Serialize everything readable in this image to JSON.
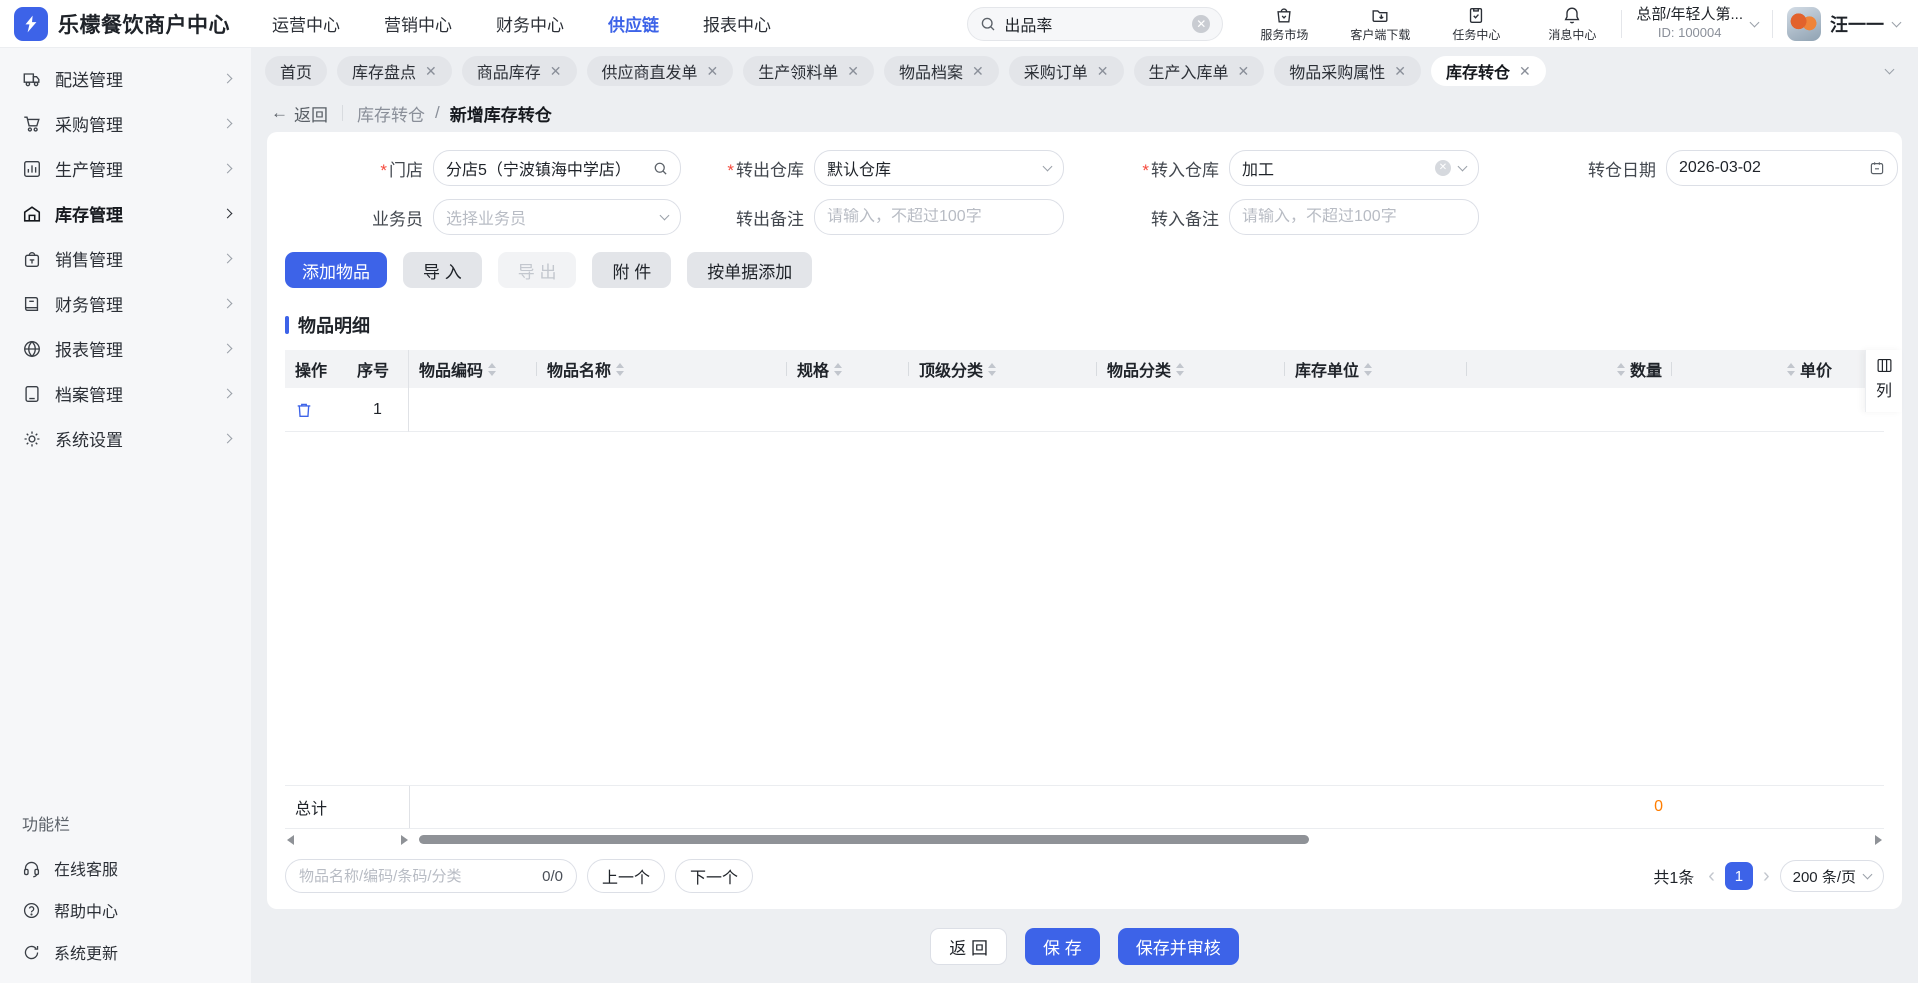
{
  "brand": {
    "name": "乐檬餐饮商户中心"
  },
  "topnav": {
    "items": [
      {
        "label": "运营中心"
      },
      {
        "label": "营销中心"
      },
      {
        "label": "财务中心"
      },
      {
        "label": "供应链",
        "active": true
      },
      {
        "label": "报表中心"
      }
    ]
  },
  "search": {
    "value": "出品率"
  },
  "utilities": {
    "items": [
      {
        "label": "服务市场"
      },
      {
        "label": "客户端下载"
      },
      {
        "label": "任务中心"
      },
      {
        "label": "消息中心"
      }
    ]
  },
  "account": {
    "org_name": "总部/年轻人第...",
    "org_id": "ID: 100004",
    "user_name": "汪一一"
  },
  "sidebar": {
    "items": [
      {
        "label": "配送管理"
      },
      {
        "label": "采购管理"
      },
      {
        "label": "生产管理"
      },
      {
        "label": "库存管理",
        "active": true
      },
      {
        "label": "销售管理"
      },
      {
        "label": "财务管理"
      },
      {
        "label": "报表管理"
      },
      {
        "label": "档案管理"
      },
      {
        "label": "系统设置"
      }
    ],
    "footer_label": "功能栏",
    "footer_items": [
      {
        "label": "在线客服"
      },
      {
        "label": "帮助中心"
      },
      {
        "label": "系统更新"
      }
    ]
  },
  "tabs": {
    "items": [
      {
        "label": "首页",
        "closable": false
      },
      {
        "label": "库存盘点",
        "closable": true
      },
      {
        "label": "商品库存",
        "closable": true
      },
      {
        "label": "供应商直发单",
        "closable": true
      },
      {
        "label": "生产领料单",
        "closable": true
      },
      {
        "label": "物品档案",
        "closable": true
      },
      {
        "label": "采购订单",
        "closable": true
      },
      {
        "label": "生产入库单",
        "closable": true
      },
      {
        "label": "物品采购属性",
        "closable": true
      },
      {
        "label": "库存转仓",
        "closable": true,
        "active": true
      }
    ]
  },
  "breadcrumb": {
    "back": "返回",
    "parent": "库存转仓",
    "separator": "/",
    "current": "新增库存转仓"
  },
  "form": {
    "store_label": "门店",
    "store_value": "分店5（宁波镇海中学店）",
    "out_wh_label": "转出仓库",
    "out_wh_value": "默认仓库",
    "in_wh_label": "转入仓库",
    "in_wh_value": "加工",
    "date_label": "转仓日期",
    "date_value": "2026-03-02",
    "salesman_label": "业务员",
    "salesman_placeholder": "选择业务员",
    "out_remark_label": "转出备注",
    "out_remark_placeholder": "请输入，不超过100字",
    "in_remark_label": "转入备注",
    "in_remark_placeholder": "请输入，不超过100字"
  },
  "toolbar": {
    "add": "添加物品",
    "import": "导 入",
    "export": "导 出",
    "attach": "附 件",
    "add_by_doc": "按单据添加"
  },
  "detail": {
    "title": "物品明细"
  },
  "table": {
    "columns": [
      {
        "label": "操作"
      },
      {
        "label": "序号"
      },
      {
        "label": "物品编码",
        "sortable": true
      },
      {
        "label": "物品名称",
        "sortable": true
      },
      {
        "label": "规格",
        "sortable": true
      },
      {
        "label": "顶级分类",
        "sortable": true
      },
      {
        "label": "物品分类",
        "sortable": true
      },
      {
        "label": "库存单位",
        "sortable": true
      },
      {
        "label": "数量",
        "sortable": true,
        "align": "right"
      },
      {
        "label": "单价",
        "sortable": true,
        "align": "right"
      }
    ],
    "rows": [
      {
        "seq": "1"
      }
    ],
    "total_label": "总计",
    "total_quantity": "0",
    "column_button": "列"
  },
  "table_footer": {
    "search_placeholder": "物品名称/编码/条码/分类",
    "counter": "0/0",
    "prev": "上一个",
    "next": "下一个"
  },
  "pagination": {
    "total": "共1条",
    "page": "1",
    "page_size": "200 条/页"
  },
  "actions": {
    "back": "返 回",
    "save": "保 存",
    "save_audit": "保存并审核"
  },
  "colors": {
    "primary": "#3d63e8",
    "accent_orange": "#ff7d00"
  }
}
